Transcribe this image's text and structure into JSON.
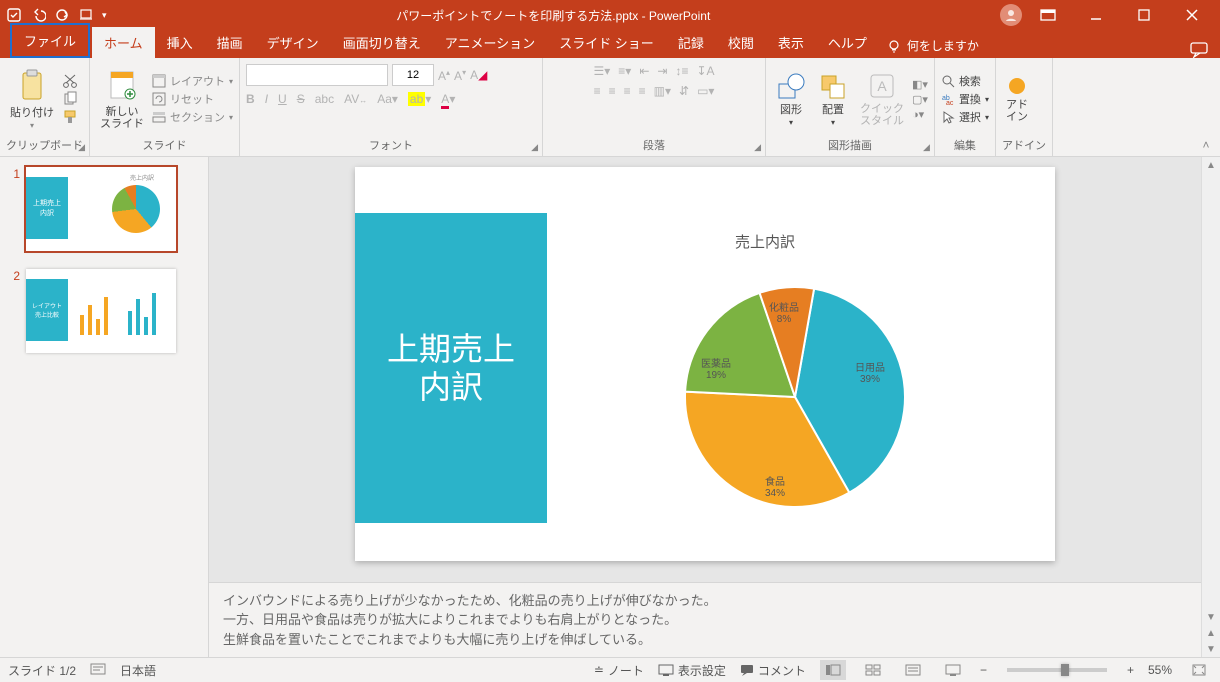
{
  "titlebar": {
    "title": "パワーポイントでノートを印刷する方法.pptx - PowerPoint"
  },
  "tabs": {
    "file": "ファイル",
    "home": "ホーム",
    "insert": "挿入",
    "draw": "描画",
    "design": "デザイン",
    "transitions": "画面切り替え",
    "animations": "アニメーション",
    "slideshow": "スライド ショー",
    "record": "記録",
    "review": "校閲",
    "view": "表示",
    "help": "ヘルプ",
    "tellme": "何をしますか"
  },
  "ribbon": {
    "clipboard": {
      "paste": "貼り付け",
      "group": "クリップボード"
    },
    "slides": {
      "new": "新しい\nスライド",
      "layout": "レイアウト",
      "reset": "リセット",
      "section": "セクション",
      "group": "スライド"
    },
    "font": {
      "size": "12",
      "group": "フォント"
    },
    "paragraph": {
      "group": "段落"
    },
    "drawing": {
      "shapes": "図形",
      "arrange": "配置",
      "quickstyles": "クイック\nスタイル",
      "group": "図形描画"
    },
    "editing": {
      "find": "検索",
      "replace": "置換",
      "select": "選択",
      "group": "編集"
    },
    "addins": {
      "btn": "アド\nイン",
      "group": "アドイン"
    }
  },
  "thumbnails": [
    {
      "num": "1"
    },
    {
      "num": "2",
      "caption": "レイアウト\n売上比較"
    }
  ],
  "slide": {
    "leftblock": "上期売上\n内訳",
    "chart_title": "売上内訳"
  },
  "chart_data": {
    "type": "pie",
    "title": "売上内訳",
    "series": [
      {
        "name": "日用品",
        "value": 39,
        "label": "日用品\n39%",
        "color": "#2bb3c9"
      },
      {
        "name": "食品",
        "value": 34,
        "label": "食品\n34%",
        "color": "#f5a623"
      },
      {
        "name": "医薬品",
        "value": 19,
        "label": "医薬品\n19%",
        "color": "#7cb342"
      },
      {
        "name": "化粧品",
        "value": 8,
        "label": "化粧品\n8%",
        "color": "#e67e22"
      }
    ]
  },
  "notes": {
    "line1": "インバウンドによる売り上げが少なかったため、化粧品の売り上げが伸びなかった。",
    "line2": "一方、日用品や食品は売りが拡大によりこれまでよりも右肩上がりとなった。",
    "line3": "生鮮食品を置いたことでこれまでよりも大幅に売り上げを伸ばしている。"
  },
  "status": {
    "slidecount": "スライド 1/2",
    "lang": "日本語",
    "notes": "ノート",
    "displaysettings": "表示設定",
    "comments": "コメント",
    "zoom": "55%"
  }
}
